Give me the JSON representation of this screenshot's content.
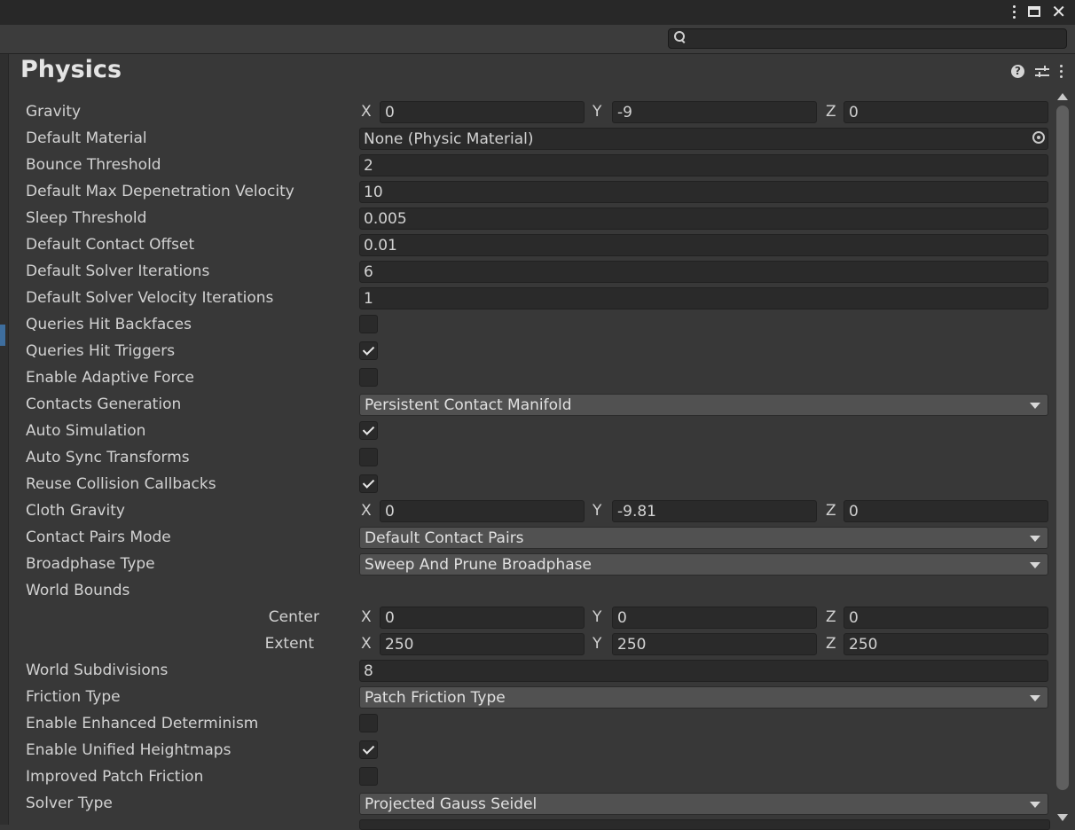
{
  "window": {
    "kebab_icon": "kebab-menu-icon",
    "maximize_icon": "maximize-icon",
    "close_icon": "close-icon",
    "close_glyph": "✕"
  },
  "search": {
    "placeholder": "",
    "value": ""
  },
  "header": {
    "title": "Physics",
    "help_glyph": "?"
  },
  "fields": {
    "gravity": {
      "label": "Gravity",
      "x_label": "X",
      "y_label": "Y",
      "z_label": "Z",
      "x": "0",
      "y": "-9",
      "z": "0"
    },
    "default_material": {
      "label": "Default Material",
      "value": "None (Physic Material)"
    },
    "bounce_threshold": {
      "label": "Bounce Threshold",
      "value": "2"
    },
    "max_depenetration": {
      "label": "Default Max Depenetration Velocity",
      "value": "10"
    },
    "sleep_threshold": {
      "label": "Sleep Threshold",
      "value": "0.005"
    },
    "contact_offset": {
      "label": "Default Contact Offset",
      "value": "0.01"
    },
    "solver_iterations": {
      "label": "Default Solver Iterations",
      "value": "6"
    },
    "solver_velocity_iterations": {
      "label": "Default Solver Velocity Iterations",
      "value": "1"
    },
    "queries_hit_backfaces": {
      "label": "Queries Hit Backfaces",
      "checked": false
    },
    "queries_hit_triggers": {
      "label": "Queries Hit Triggers",
      "checked": true
    },
    "enable_adaptive_force": {
      "label": "Enable Adaptive Force",
      "checked": false
    },
    "contacts_generation": {
      "label": "Contacts Generation",
      "value": "Persistent Contact Manifold"
    },
    "auto_simulation": {
      "label": "Auto Simulation",
      "checked": true
    },
    "auto_sync_transforms": {
      "label": "Auto Sync Transforms",
      "checked": false
    },
    "reuse_collision_callbacks": {
      "label": "Reuse Collision Callbacks",
      "checked": true
    },
    "cloth_gravity": {
      "label": "Cloth Gravity",
      "x_label": "X",
      "y_label": "Y",
      "z_label": "Z",
      "x": "0",
      "y": "-9.81",
      "z": "0"
    },
    "contact_pairs_mode": {
      "label": "Contact Pairs Mode",
      "value": "Default Contact Pairs"
    },
    "broadphase_type": {
      "label": "Broadphase Type",
      "value": "Sweep And Prune Broadphase"
    },
    "world_bounds": {
      "label": "World Bounds",
      "center": {
        "label": "Center",
        "x_label": "X",
        "y_label": "Y",
        "z_label": "Z",
        "x": "0",
        "y": "0",
        "z": "0"
      },
      "extent": {
        "label": "Extent",
        "x_label": "X",
        "y_label": "Y",
        "z_label": "Z",
        "x": "250",
        "y": "250",
        "z": "250"
      }
    },
    "world_subdivisions": {
      "label": "World Subdivisions",
      "value": "8"
    },
    "friction_type": {
      "label": "Friction Type",
      "value": "Patch Friction Type"
    },
    "enhanced_determinism": {
      "label": "Enable Enhanced Determinism",
      "checked": false
    },
    "unified_heightmaps": {
      "label": "Enable Unified Heightmaps",
      "checked": true
    },
    "improved_patch_friction": {
      "label": "Improved Patch Friction",
      "checked": false
    },
    "solver_type": {
      "label": "Solver Type",
      "value": "Projected Gauss Seidel"
    }
  }
}
